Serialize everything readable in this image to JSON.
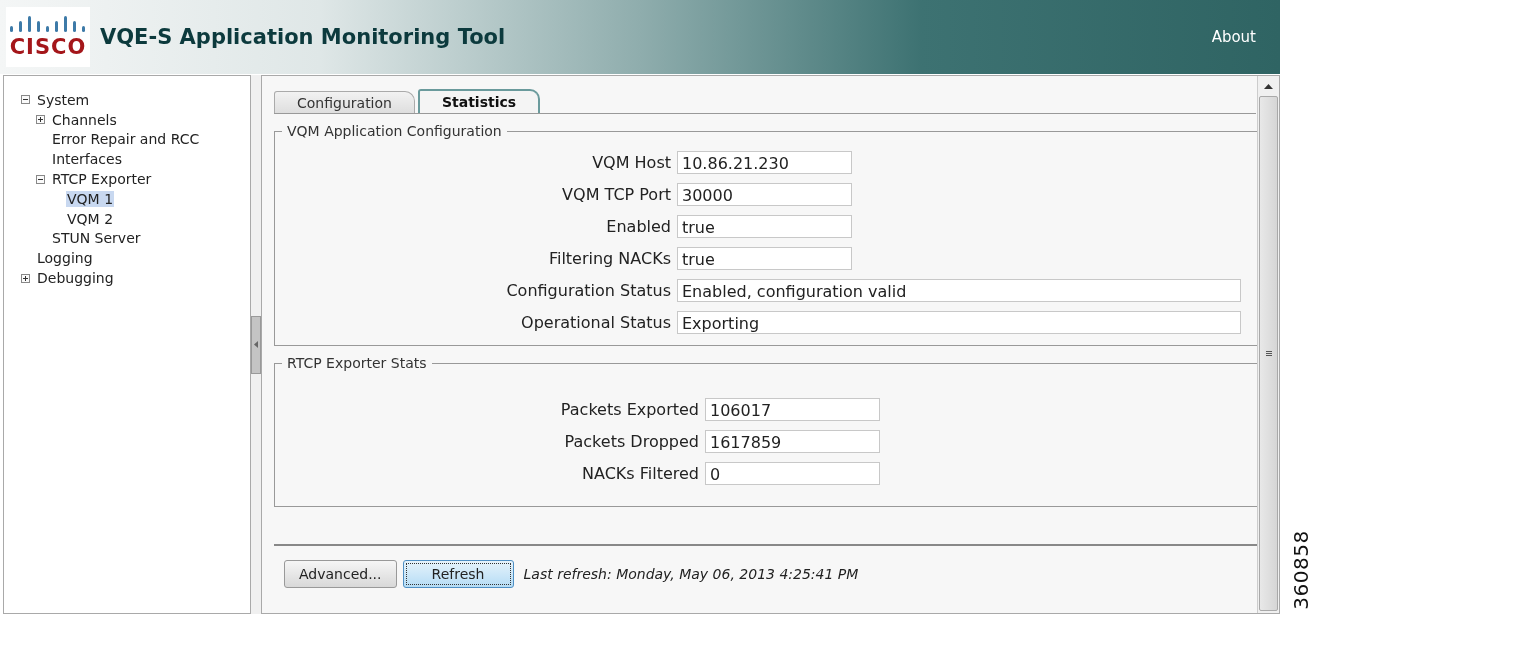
{
  "header": {
    "logo_text": "CISCO",
    "title": "VQE-S Application Monitoring Tool",
    "about_link": "About"
  },
  "tree": {
    "items": [
      {
        "label": "System",
        "expanded": true,
        "selected": false,
        "children": [
          {
            "label": "Channels",
            "expanded": false,
            "selected": false
          },
          {
            "label": "Error Repair and RCC",
            "selected": false
          },
          {
            "label": "Interfaces",
            "selected": false
          },
          {
            "label": "RTCP Exporter",
            "expanded": true,
            "selected": false,
            "children": [
              {
                "label": "VQM 1",
                "selected": true
              },
              {
                "label": "VQM 2",
                "selected": false
              }
            ]
          },
          {
            "label": "STUN Server",
            "selected": false
          }
        ]
      },
      {
        "label": "Logging",
        "selected": false
      },
      {
        "label": "Debugging",
        "expanded": false,
        "selected": false
      }
    ]
  },
  "tabs": [
    {
      "label": "Configuration",
      "selected": false
    },
    {
      "label": "Statistics",
      "selected": true
    }
  ],
  "sections": [
    {
      "title": "VQM Application Configuration",
      "fields": [
        {
          "label": "VQM Host",
          "value": "10.86.21.230",
          "kind": "short"
        },
        {
          "label": "VQM TCP Port",
          "value": "30000",
          "kind": "short"
        },
        {
          "label": "Enabled",
          "value": "true",
          "kind": "short"
        },
        {
          "label": "Filtering NACKs",
          "value": "true",
          "kind": "short"
        },
        {
          "label": "Configuration Status",
          "value": "Enabled, configuration valid",
          "kind": "long"
        },
        {
          "label": "Operational Status",
          "value": "Exporting",
          "kind": "long"
        }
      ]
    },
    {
      "title": "RTCP Exporter Stats",
      "fields": [
        {
          "label": "Packets Exported",
          "value": "106017",
          "kind": "short"
        },
        {
          "label": "Packets Dropped",
          "value": "1617859",
          "kind": "short"
        },
        {
          "label": "NACKs Filtered",
          "value": "0",
          "kind": "short"
        }
      ]
    }
  ],
  "buttons": [
    {
      "label": "Advanced...",
      "selected": false
    },
    {
      "label": "Refresh",
      "selected": true
    }
  ],
  "last_refresh": "Last refresh: Monday, May 06, 2013 4:25:41 PM",
  "figure_number": "360858"
}
